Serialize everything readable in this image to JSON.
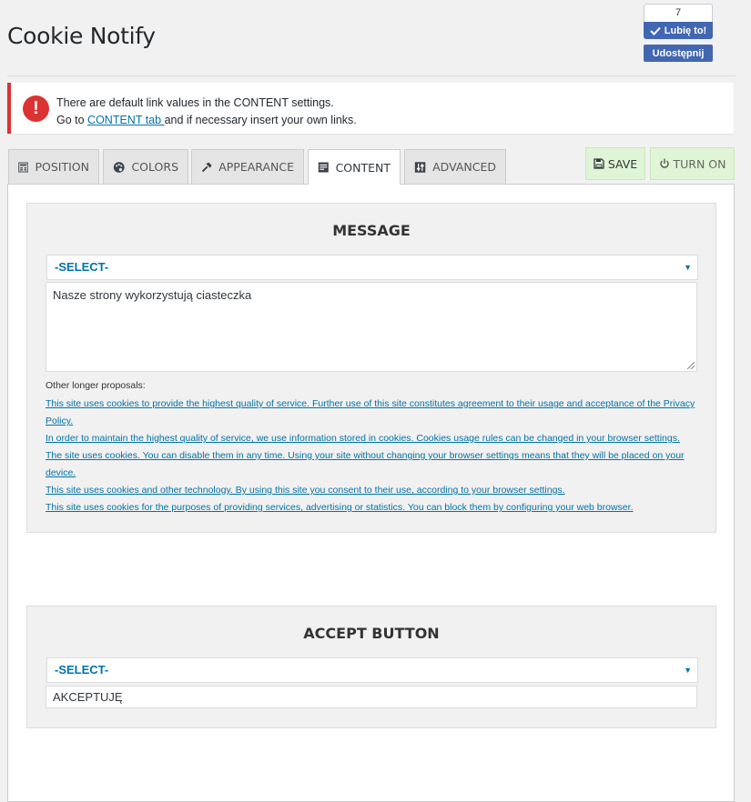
{
  "page": {
    "title": "Cookie Notify"
  },
  "like_widget": {
    "count": "7",
    "like_label": "Lubię to!",
    "share_label": "Udostępnij"
  },
  "notice": {
    "line1": "There are default link values in the CONTENT settings.",
    "line2_prefix": "Go to ",
    "line2_link": "CONTENT tab ",
    "line2_suffix": "and if necessary insert your own links."
  },
  "tabs": [
    {
      "label": "POSITION",
      "icon": "grid-icon"
    },
    {
      "label": "COLORS",
      "icon": "palette-icon"
    },
    {
      "label": "APPEARANCE",
      "icon": "hammer-icon"
    },
    {
      "label": "CONTENT",
      "icon": "document-icon",
      "active": true
    },
    {
      "label": "ADVANCED",
      "icon": "sliders-icon"
    }
  ],
  "actions": {
    "save": "SAVE",
    "turn_on": "TURN ON"
  },
  "message_box": {
    "heading": "MESSAGE",
    "select_value": "-SELECT-",
    "message_text": "Nasze strony wykorzystują ciasteczka",
    "proposals_label": "Other longer proposals:",
    "proposals": [
      "This site uses cookies to provide the highest quality of service. Further use of this site constitutes agreement to their usage and acceptance of the Privacy Policy.",
      "In order to maintain the highest quality of service, we use information stored in cookies. Cookies usage rules can be changed in your browser settings.",
      "The site uses cookies. You can disable them in any time. Using your site without changing your browser settings means that they will be placed on your device.",
      "This site uses cookies and other technology. By using this site you consent to their use, according to your browser settings.",
      "This site uses cookies for the purposes of providing services, advertising or statistics. You can block them by configuring your web browser."
    ]
  },
  "accept_box": {
    "heading": "ACCEPT BUTTON",
    "select_value": "-SELECT-",
    "button_text": "AKCEPTUJĘ"
  },
  "colors": {
    "accent": "#0073aa",
    "error": "#dc3232",
    "save_bg": "#dff5d6",
    "facebook": "#4267b2"
  }
}
